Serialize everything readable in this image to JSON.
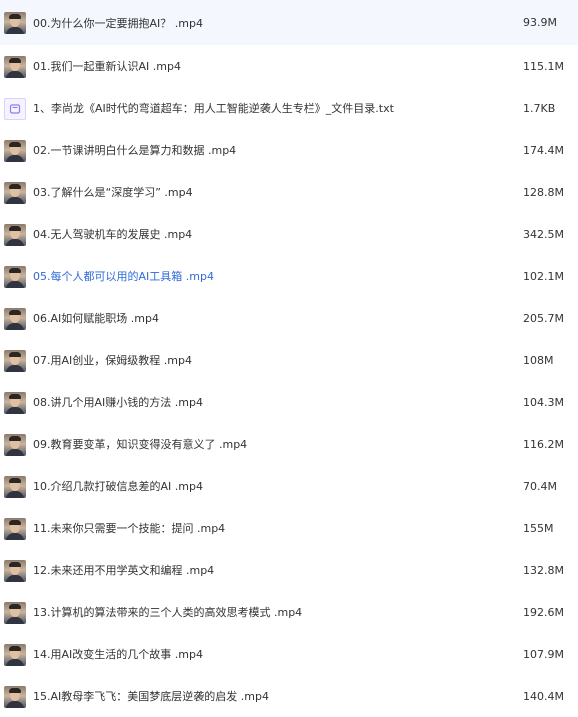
{
  "colors": {
    "selected_row_bg": "#f5f7ff",
    "active_text": "#2f6bd8",
    "text": "#333333"
  },
  "files": [
    {
      "icon": "video-thumbnail-icon",
      "name": "00.为什么你一定要拥抱AI？ .mp4",
      "size": "93.9M"
    },
    {
      "icon": "video-thumbnail-icon",
      "name": "01.我们一起重新认识AI .mp4",
      "size": "115.1M"
    },
    {
      "icon": "text-file-icon",
      "name": "1、李尚龙《AI时代的弯道超车：用人工智能逆袭人生专栏》_文件目录.txt",
      "size": "1.7KB"
    },
    {
      "icon": "video-thumbnail-icon",
      "name": "02.一节课讲明白什么是算力和数据 .mp4",
      "size": "174.4M"
    },
    {
      "icon": "video-thumbnail-icon",
      "name": "03.了解什么是“深度学习” .mp4",
      "size": "128.8M"
    },
    {
      "icon": "video-thumbnail-icon",
      "name": "04.无人驾驶机车的发展史 .mp4",
      "size": "342.5M"
    },
    {
      "icon": "video-thumbnail-icon",
      "name": "05.每个人都可以用的AI工具箱 .mp4",
      "size": "102.1M",
      "active": true
    },
    {
      "icon": "video-thumbnail-icon",
      "name": "06.AI如何赋能职场 .mp4",
      "size": "205.7M"
    },
    {
      "icon": "video-thumbnail-icon",
      "name": "07.用AI创业，保姆级教程 .mp4",
      "size": "108M"
    },
    {
      "icon": "video-thumbnail-icon",
      "name": "08.讲几个用AI赚小钱的方法 .mp4",
      "size": "104.3M"
    },
    {
      "icon": "video-thumbnail-icon",
      "name": "09.教育要变革，知识变得没有意义了 .mp4",
      "size": "116.2M"
    },
    {
      "icon": "video-thumbnail-icon",
      "name": "10.介绍几款打破信息差的AI .mp4",
      "size": "70.4M"
    },
    {
      "icon": "video-thumbnail-icon",
      "name": "11.未来你只需要一个技能：提问 .mp4",
      "size": "155M"
    },
    {
      "icon": "video-thumbnail-icon",
      "name": "12.未来还用不用学英文和编程 .mp4",
      "size": "132.8M"
    },
    {
      "icon": "video-thumbnail-icon",
      "name": "13.计算机的算法带来的三个人类的高效思考模式 .mp4",
      "size": "192.6M"
    },
    {
      "icon": "video-thumbnail-icon",
      "name": "14.用AI改变生活的几个故事 .mp4",
      "size": "107.9M"
    },
    {
      "icon": "video-thumbnail-icon",
      "name": "15.AI教母李飞飞：美国梦底层逆袭的启发 .mp4",
      "size": "140.4M"
    }
  ]
}
